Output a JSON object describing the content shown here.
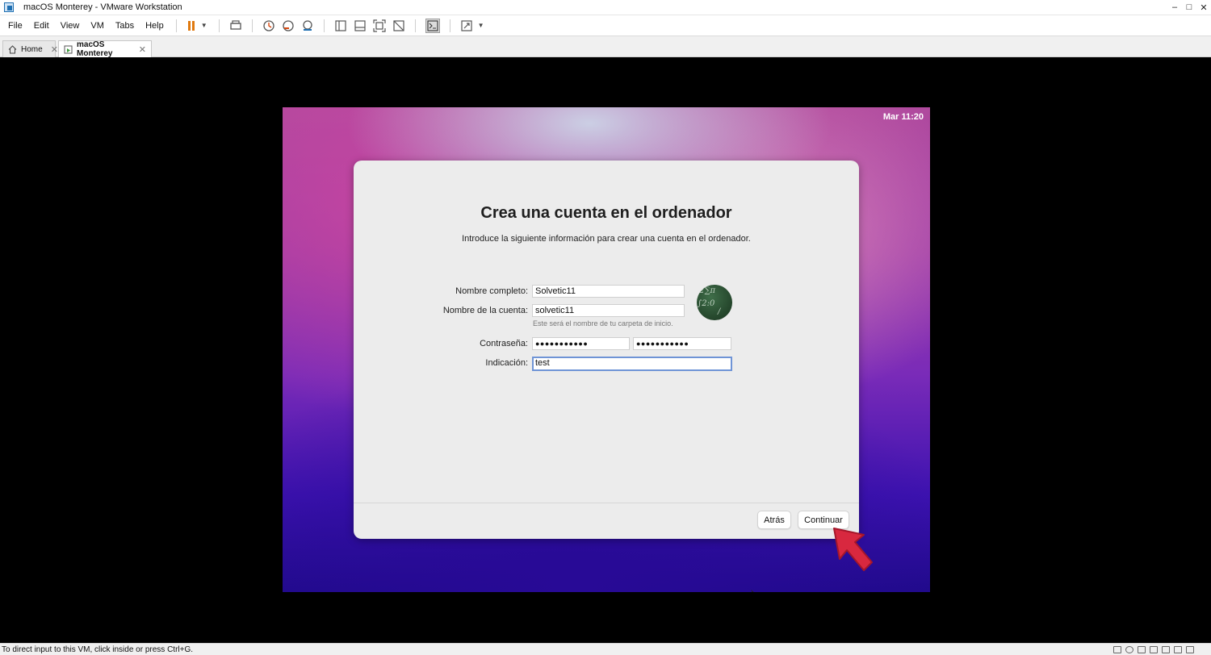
{
  "window": {
    "title": "macOS Monterey - VMware Workstation",
    "controls": [
      "–",
      "□",
      "✕"
    ]
  },
  "menu": {
    "items": [
      "File",
      "Edit",
      "View",
      "VM",
      "Tabs",
      "Help"
    ]
  },
  "tabs": [
    {
      "label": "Home",
      "close": "✕"
    },
    {
      "label": "macOS Monterey",
      "close": "✕"
    }
  ],
  "guest": {
    "clock": "Mar 11:20",
    "dialog": {
      "title": "Crea una cuenta en el ordenador",
      "subtitle": "Introduce la siguiente información para crear una cuenta en el ordenador.",
      "full_name_label": "Nombre completo:",
      "full_name_value": "Solvetic11",
      "account_label": "Nombre de la cuenta:",
      "account_value": "solvetic11",
      "account_hint": "Este será el nombre de tu carpeta de inicio.",
      "password_label": "Contraseña:",
      "password_value": "●●●●●●●●●●●",
      "password_verify_value": "●●●●●●●●●●●",
      "hint_label": "Indicación:",
      "hint_value": "test",
      "back_button": "Atrás",
      "continue_button": "Continuar"
    }
  },
  "status": {
    "text": "To direct input to this VM, click inside or press Ctrl+G."
  },
  "colors": {
    "pause": "#e07a10",
    "focus_ring": "#6f94d6",
    "arrow": "#d8283f"
  }
}
